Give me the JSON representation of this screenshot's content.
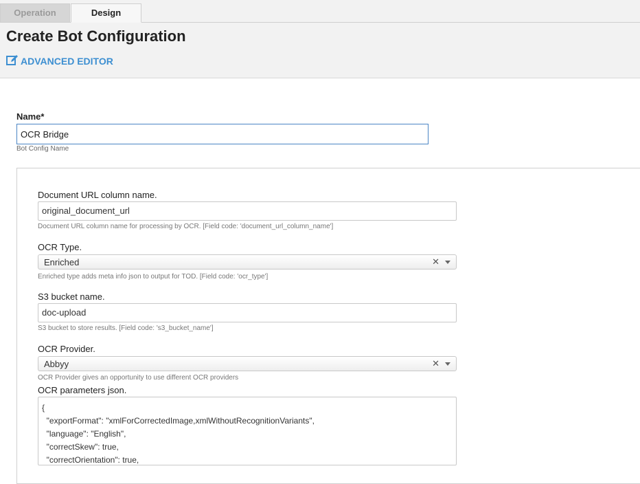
{
  "tabs": [
    {
      "label": "Operation",
      "active": false
    },
    {
      "label": "Design",
      "active": true
    }
  ],
  "page_title": "Create Bot Configuration",
  "advanced_editor": {
    "label": "ADVANCED EDITOR",
    "icon": "edit-icon"
  },
  "name_field": {
    "label": "Name*",
    "value": "OCR Bridge",
    "help": "Bot Config Name"
  },
  "fields": {
    "document_url": {
      "label": "Document URL column name.",
      "value": "original_document_url",
      "help": "Document URL column name for processing by OCR. [Field code: 'document_url_column_name']"
    },
    "ocr_type": {
      "label": "OCR Type.",
      "value": "Enriched",
      "clear": "✕",
      "help": "Enriched type adds meta info json to output for TOD. [Field code: 'ocr_type']"
    },
    "s3_bucket": {
      "label": "S3 bucket name.",
      "value": "doc-upload",
      "help": "S3 bucket to store results. [Field code: 's3_bucket_name']"
    },
    "ocr_provider": {
      "label": "OCR Provider.",
      "value": "Abbyy",
      "clear": "✕",
      "help": "OCR Provider gives an opportunity to use different OCR providers"
    },
    "ocr_params": {
      "label": "OCR parameters json.",
      "lines": [
        "{",
        "  \"exportFormat\": \"xmlForCorrectedImage,xmlWithoutRecognitionVariants\",",
        "  \"language\": \"English\",",
        "  \"correctSkew\": true,",
        "  \"correctOrientation\": true,"
      ]
    }
  },
  "colors": {
    "accent": "#3d8fd1",
    "focus_border": "#4a84c4"
  }
}
